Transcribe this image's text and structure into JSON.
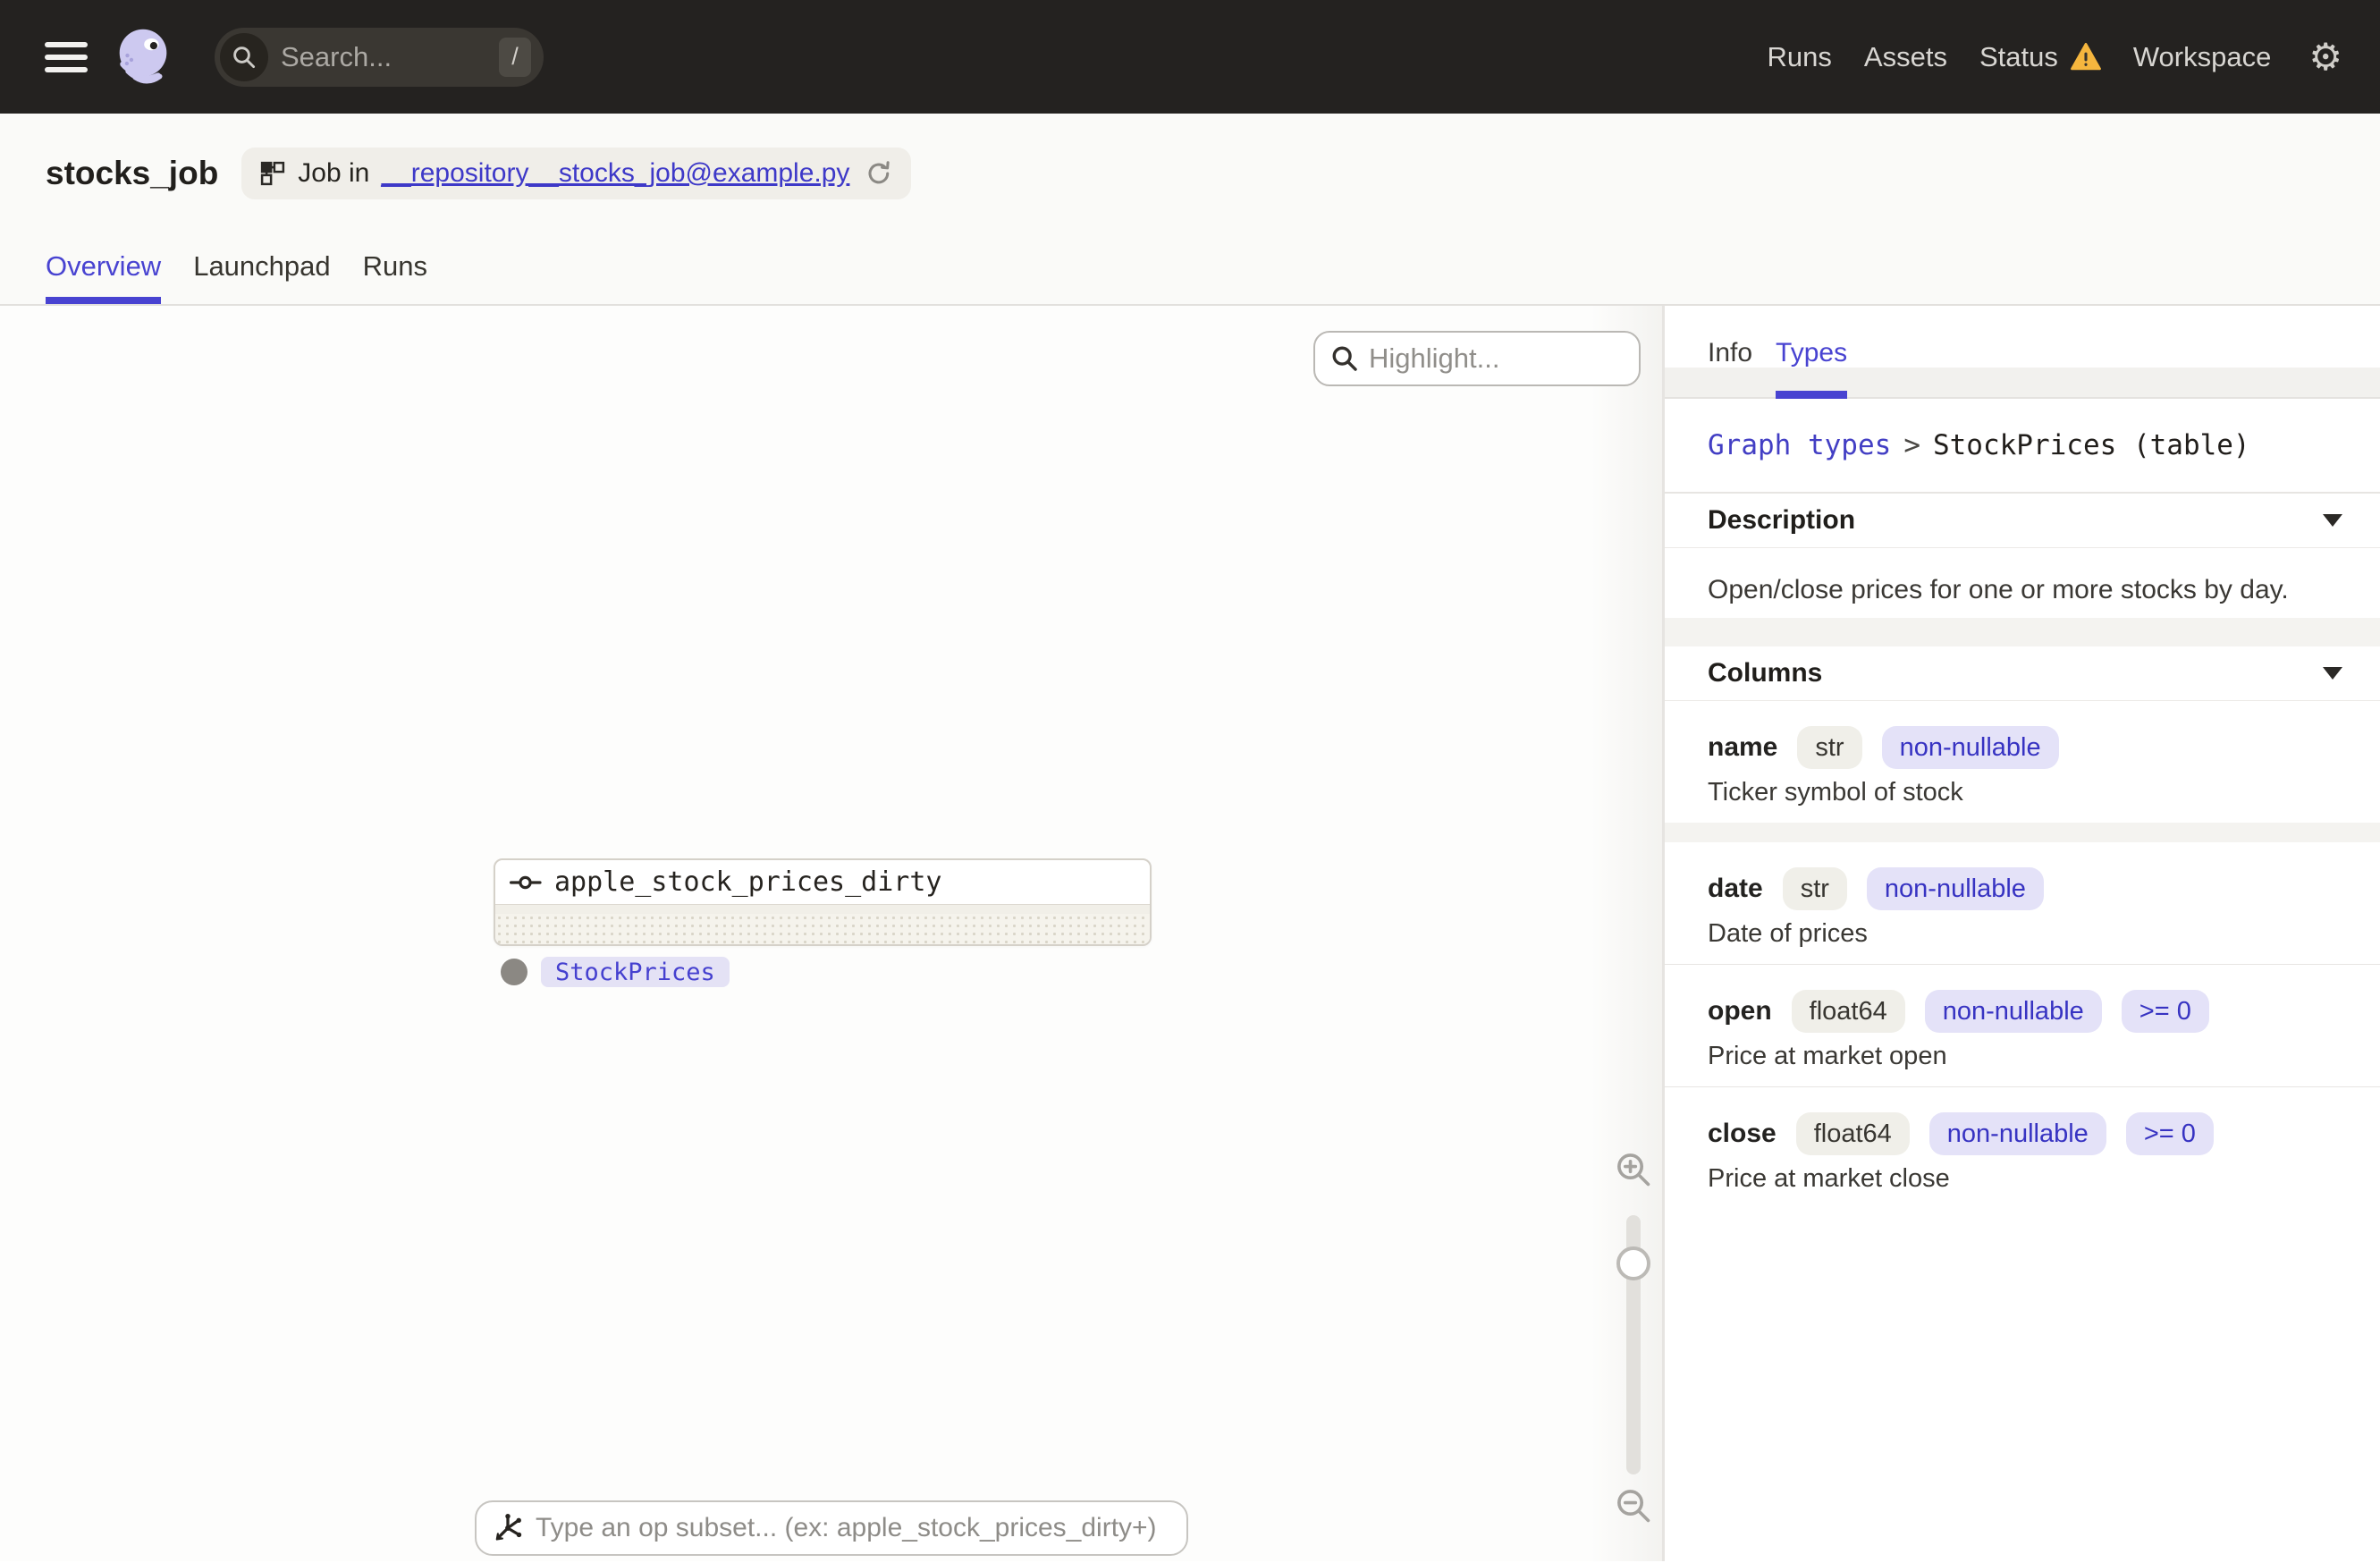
{
  "navbar": {
    "search_placeholder": "Search...",
    "search_shortcut": "/",
    "links": {
      "runs": "Runs",
      "assets": "Assets",
      "status": "Status",
      "workspace": "Workspace"
    },
    "settings_glyph": "⚙"
  },
  "header": {
    "title": "stocks_job",
    "job_tag_prefix": "Job in",
    "job_tag_link": "__repository__stocks_job@example.py",
    "tabs": {
      "overview": "Overview",
      "launchpad": "Launchpad",
      "runs": "Runs"
    }
  },
  "graph": {
    "highlight_placeholder": "Highlight...",
    "node_label": "apple_stock_prices_dirty",
    "output_type_tag": "StockPrices",
    "op_subset_placeholder": "Type an op subset... (ex: apple_stock_prices_dirty+)"
  },
  "sidebar": {
    "tabs": {
      "info": "Info",
      "types": "Types"
    },
    "breadcrumb": {
      "parent": "Graph types",
      "separator": ">",
      "current": "StockPrices (table)"
    },
    "description": {
      "title": "Description",
      "body": "Open/close prices for one or more stocks by day."
    },
    "columns": {
      "title": "Columns",
      "items": [
        {
          "name": "name",
          "badges": [
            "str",
            "non-nullable"
          ],
          "description": "Ticker symbol of stock"
        },
        {
          "name": "date",
          "badges": [
            "str",
            "non-nullable"
          ],
          "description": "Date of prices"
        },
        {
          "name": "open",
          "badges": [
            "float64",
            "non-nullable",
            ">= 0"
          ],
          "description": "Price at market open"
        },
        {
          "name": "close",
          "badges": [
            "float64",
            "non-nullable",
            ">= 0"
          ],
          "description": "Price at market close"
        }
      ]
    }
  },
  "icons": {
    "hamburger": "menu",
    "logo": "dagster-octopus",
    "search": "magnifier",
    "warning": "amber-triangle",
    "settings": "gear",
    "job": "schema-squares",
    "refresh": "circular-arrow",
    "op": "line-circle-line",
    "zoom_in": "magnifier-plus",
    "zoom_out": "magnifier-minus",
    "op_selector": "node-star",
    "section_chevron": "triangle-down",
    "output_port": "gray-dot"
  },
  "colors": {
    "navbar_bg": "#242220",
    "accent": "#4843D1",
    "link": "#3E39C8",
    "warning": "#F5B63E",
    "badge_gray_bg": "#F0EFE9",
    "badge_purple_bg": "#E4E2F8",
    "badge_purple_text": "#3733C2",
    "band": "#F4F3F0",
    "header_bg": "#FAFAF8"
  }
}
